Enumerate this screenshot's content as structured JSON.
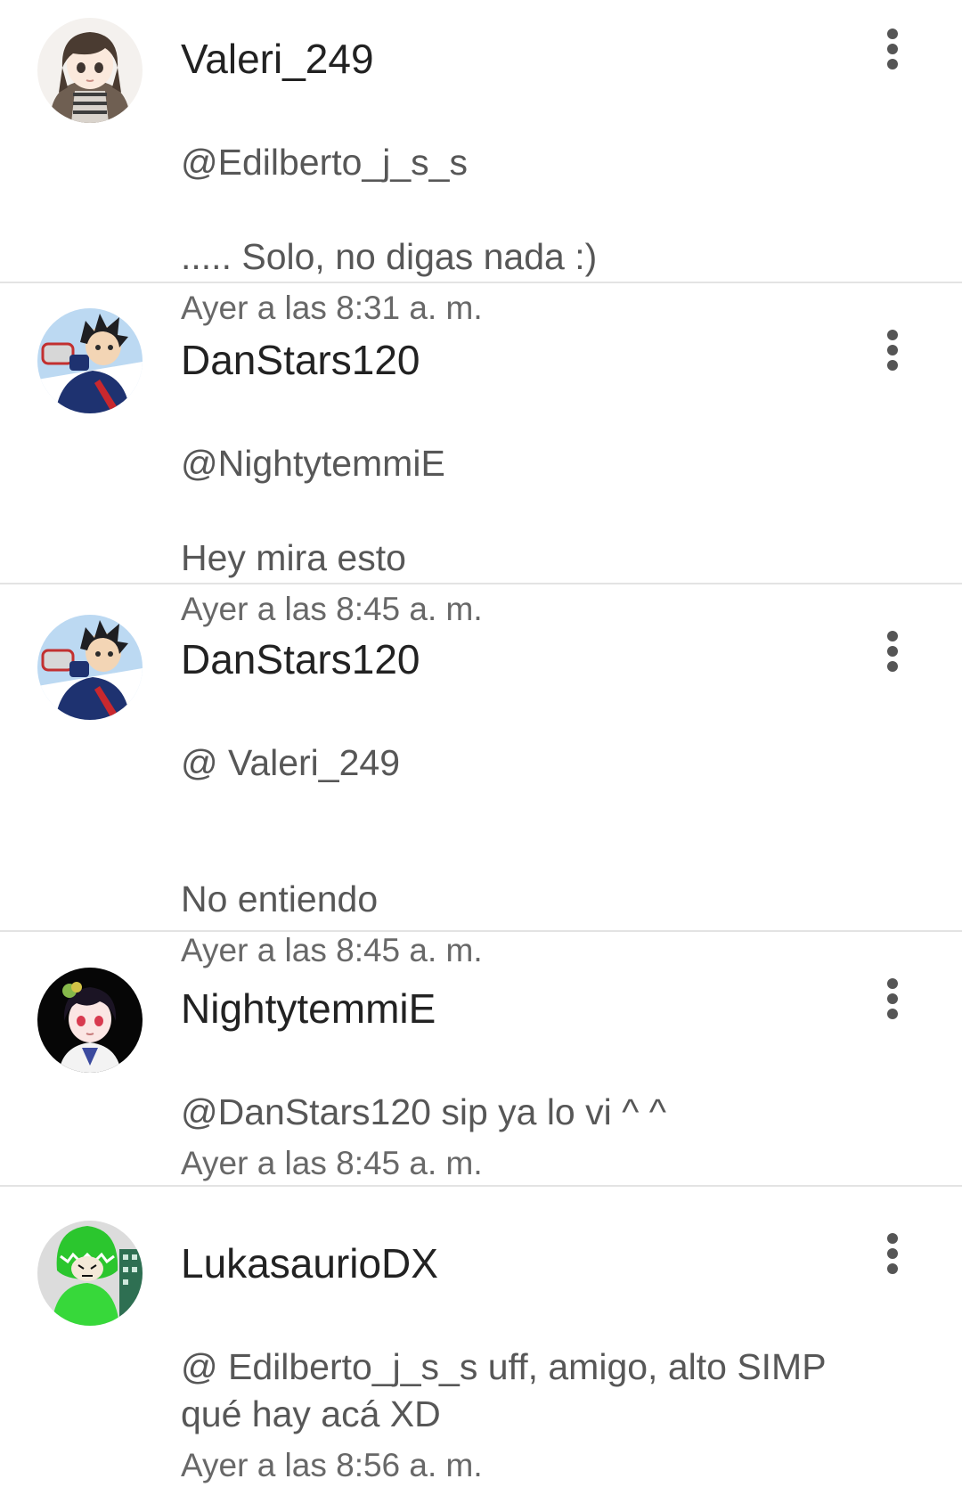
{
  "comments": [
    {
      "username": "Valeri_249",
      "mention": "@Edilberto_j_s_s",
      "text": "..... Solo, no digas nada :)",
      "timestamp": "Ayer a las 8:31 a. m.",
      "avatar_icon": "anime-girl-avatar-icon"
    },
    {
      "username": "DanStars120",
      "mention": "@NightytemmiE",
      "text": "Hey mira esto",
      "timestamp": "Ayer a las 8:45 a. m.",
      "avatar_icon": "anime-boy-avatar-icon"
    },
    {
      "username": "DanStars120",
      "mention": "@ Valeri_249",
      "text": "No entiendo",
      "timestamp": "Ayer a las 8:45 a. m.",
      "avatar_icon": "anime-boy-avatar-icon"
    },
    {
      "username": "NightytemmiE",
      "mention": "@DanStars120",
      "text": " sip ya lo vi ^ ^",
      "timestamp": "Ayer a las 8:45 a. m.",
      "avatar_icon": "anime-girl-dark-hair-avatar-icon"
    },
    {
      "username": "LukasaurioDX",
      "mention": "@ Edilberto_j_s_s",
      "text": "  uff, amigo, alto SIMP qué hay acá XD",
      "timestamp": "Ayer a las 8:56 a. m.",
      "avatar_icon": "green-dino-avatar-icon"
    }
  ],
  "more_icon": "more-vertical-icon",
  "colors": {
    "background": "#ffffff",
    "divider": "#e3e3e3",
    "username": "#222222",
    "body_text": "#575757",
    "timestamp": "#686868",
    "menu_dots": "#555555"
  }
}
